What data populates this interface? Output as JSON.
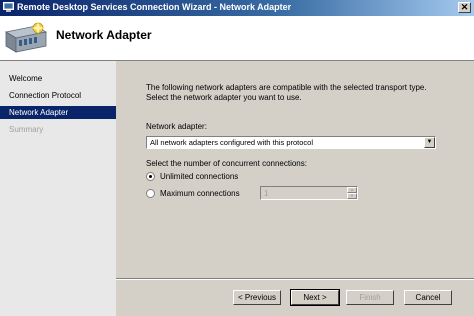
{
  "window": {
    "title": "Remote Desktop Services Connection Wizard - Network Adapter",
    "close_glyph": "✕"
  },
  "header": {
    "title": "Network Adapter",
    "icon": "server-icon"
  },
  "nav": {
    "items": [
      {
        "label": "Welcome",
        "state": "normal"
      },
      {
        "label": "Connection Protocol",
        "state": "normal"
      },
      {
        "label": "Network Adapter",
        "state": "active"
      },
      {
        "label": "Summary",
        "state": "disabled"
      }
    ]
  },
  "main": {
    "description": "The following network adapters are compatible with the selected transport type. Select the network adapter you want to use.",
    "adapter_label": "Network adapter:",
    "adapter_value": "All network adapters configured with this protocol",
    "connections_label": "Select the number of concurrent connections:",
    "unlimited_label": "Unlimited connections",
    "unlimited_checked": true,
    "maximum_label": "Maximum connections",
    "maximum_value": "1"
  },
  "buttons": {
    "back": "< Previous",
    "next": "Next >",
    "finish": "Finish",
    "cancel": "Cancel"
  },
  "colors": {
    "title_bar": "#0a246a",
    "selected": "#0a246a",
    "face": "#d4d0c8"
  }
}
